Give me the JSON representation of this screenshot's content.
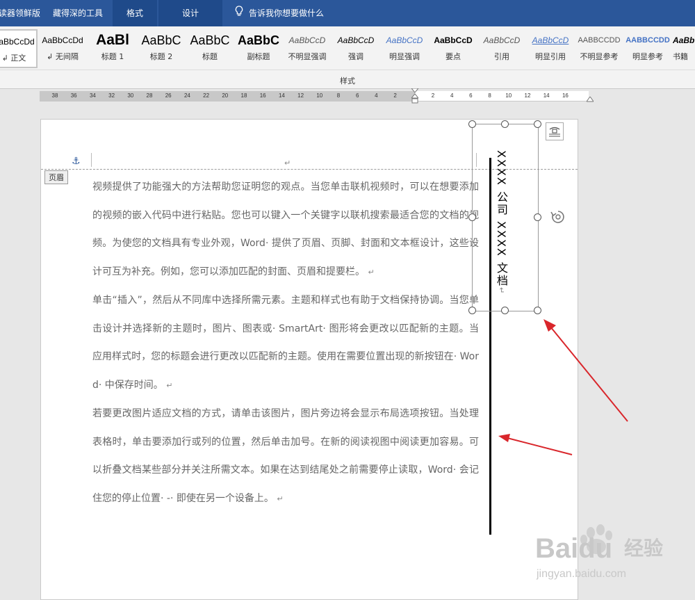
{
  "tabs": [
    {
      "label": "读器领鲜版",
      "active": false
    },
    {
      "label": "藏得深的工具",
      "active": false
    },
    {
      "label": "格式",
      "active": true
    },
    {
      "label": "设计",
      "active": true
    },
    {
      "label": "告诉我你想要做什么",
      "active": false
    }
  ],
  "styles_gallery": {
    "section_label": "样式",
    "items": [
      {
        "sample": "AaBbCcDd",
        "name": "↲ 正文",
        "selected": true
      },
      {
        "sample": "AaBbCcDd",
        "name": "↲ 无间隔",
        "selected": false
      },
      {
        "sample": "AaBl",
        "name": "标题 1",
        "selected": false
      },
      {
        "sample": "AaBbC",
        "name": "标题 2",
        "selected": false
      },
      {
        "sample": "AaBbC",
        "name": "标题",
        "selected": false
      },
      {
        "sample": "AaBbC",
        "name": "副标题",
        "selected": false
      },
      {
        "sample": "AaBbCcD",
        "name": "不明显强调",
        "selected": false
      },
      {
        "sample": "AaBbCcD",
        "name": "强调",
        "selected": false
      },
      {
        "sample": "AaBbCcD",
        "name": "明显强调",
        "selected": false
      },
      {
        "sample": "AaBbCcD",
        "name": "要点",
        "selected": false
      },
      {
        "sample": "AaBbCcD",
        "name": "引用",
        "selected": false
      },
      {
        "sample": "AaBbCcD",
        "name": "明显引用",
        "selected": false
      },
      {
        "sample": "AABBCCDD",
        "name": "不明显参考",
        "selected": false
      },
      {
        "sample": "AABBCCDD",
        "name": "明显参考",
        "selected": false
      },
      {
        "sample": "AaBb",
        "name": "书籍",
        "selected": false
      }
    ]
  },
  "ruler": {
    "ticks": [
      "38",
      "36",
      "34",
      "32",
      "30",
      "28",
      "26",
      "24",
      "22",
      "20",
      "18",
      "16",
      "14",
      "12",
      "10",
      "8",
      "6",
      "4",
      "2",
      "",
      "2",
      "4",
      "6",
      "8",
      "10",
      "12",
      "14",
      "16"
    ]
  },
  "document": {
    "header_tag": "页眉",
    "header_para_mark": "↵",
    "textbox_text": "XXXX 公司 XXXX 文档",
    "textbox_para_mark": "↵",
    "paragraphs": [
      "视频提供了功能强大的方法帮助您证明您的观点。当您单击联机视频时，可以在想要添加的视频的嵌入代码中进行粘贴。您也可以键入一个关键字以联机搜索最适合您的文档的视频。为使您的文档具有专业外观，Word· 提供了页眉、页脚、封面和文本框设计，这些设计可互为补充。例如，您可以添加匹配的封面、页眉和提要栏。",
      "单击“插入”，然后从不同库中选择所需元素。主题和样式也有助于文档保持协调。当您单击设计并选择新的主题时，图片、图表或· SmartArt· 图形将会更改以匹配新的主题。当应用样式时，您的标题会进行更改以匹配新的主题。使用在需要位置出现的新按钮在· Word· 中保存时间。",
      "若要更改图片适应文档的方式，请单击该图片，图片旁边将会显示布局选项按钮。当处理表格时，单击要添加行或列的位置，然后单击加号。在新的阅读视图中阅读更加容易。可以折叠文档某些部分并关注所需文本。如果在达到结尾处之前需要停止读取，Word· 会记住您的停止位置· -· 即使在另一个设备上。"
    ],
    "para_mark": "↵"
  },
  "watermark": {
    "brand": "Baidu",
    "brand_cn": "经验",
    "url": "jingyan.baidu.com"
  },
  "colors": {
    "title_bar": "#2b579a",
    "annotation_arrow": "#d9262b"
  }
}
